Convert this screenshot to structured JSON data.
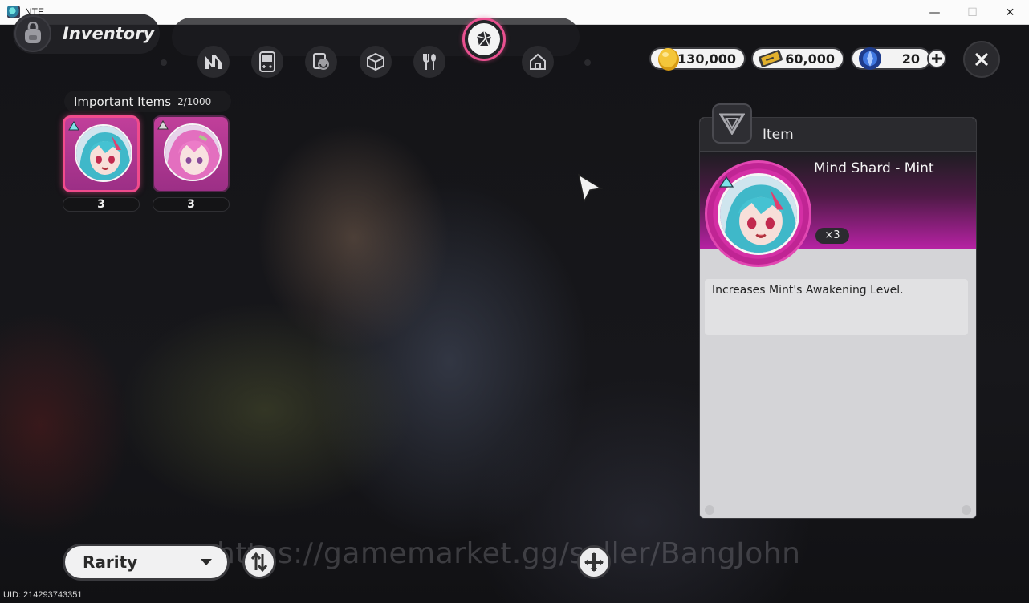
{
  "window": {
    "title": "NTE",
    "minimize": "—",
    "maximize": "☐",
    "close": "✕"
  },
  "header": {
    "title": "Inventory"
  },
  "tabs": [
    {
      "icon": "n-logo-icon"
    },
    {
      "icon": "handheld-console-icon"
    },
    {
      "icon": "photo-card-icon"
    },
    {
      "icon": "cube-box-icon"
    },
    {
      "icon": "fork-spoon-icon"
    },
    {
      "icon": "gem-shard-icon",
      "active": true
    },
    {
      "icon": "house-icon"
    }
  ],
  "currencies": [
    {
      "icon": "gold-coin-icon",
      "value": "130,000"
    },
    {
      "icon": "ticket-icon",
      "value": "60,000"
    },
    {
      "icon": "blue-crystal-icon",
      "value": "20"
    }
  ],
  "section": {
    "name": "Important Items",
    "count": "2/1000"
  },
  "items": [
    {
      "count": "3",
      "selected": true
    },
    {
      "count": "3",
      "selected": false
    }
  ],
  "detail": {
    "header_label": "Item",
    "name": "Mind Shard - Mint",
    "quantity": "×3",
    "description": "Increases Mint's Awakening Level."
  },
  "bottom": {
    "sort_label": "Rarity"
  },
  "watermark": "https://gamemarket.gg/seller/BangJohn",
  "uid": "UID: 214293743351",
  "colors": {
    "accent_pink": "#e8508f",
    "rarity_magenta": "#b722a4"
  }
}
